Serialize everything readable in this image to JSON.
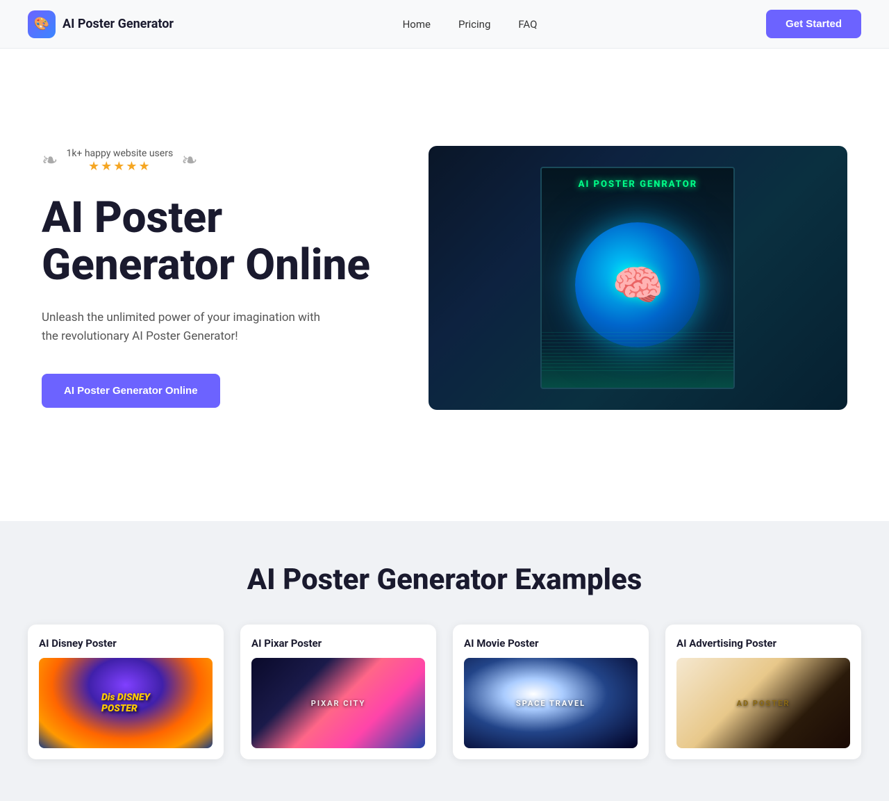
{
  "nav": {
    "brand_icon": "🎨",
    "brand_title": "AI Poster Generator",
    "links": [
      {
        "label": "Home",
        "id": "home"
      },
      {
        "label": "Pricing",
        "id": "pricing"
      },
      {
        "label": "FAQ",
        "id": "faq"
      }
    ],
    "cta_label": "Get Started"
  },
  "hero": {
    "badge_text": "1k+ happy website users",
    "stars": "★★★★★",
    "title": "AI Poster Generator Online",
    "subtitle": "Unleash the unlimited power of your imagination with the revolutionary AI Poster Generator!",
    "cta_label": "AI Poster Generator Online",
    "poster_label": "AI POSTER GENRATOR"
  },
  "examples": {
    "section_title": "AI Poster Generator Examples",
    "cards": [
      {
        "title": "AI Disney Poster",
        "style": "disney",
        "img_text": "Dis DISNEY POSTER"
      },
      {
        "title": "AI Pixar Poster",
        "style": "pixar",
        "img_text": "PIXAR CITY"
      },
      {
        "title": "AI Movie Poster",
        "style": "movie",
        "img_text": "SPACE TRAVEL"
      },
      {
        "title": "AI Advertising Poster",
        "style": "advertising",
        "img_text": "AD POSTER"
      }
    ]
  }
}
